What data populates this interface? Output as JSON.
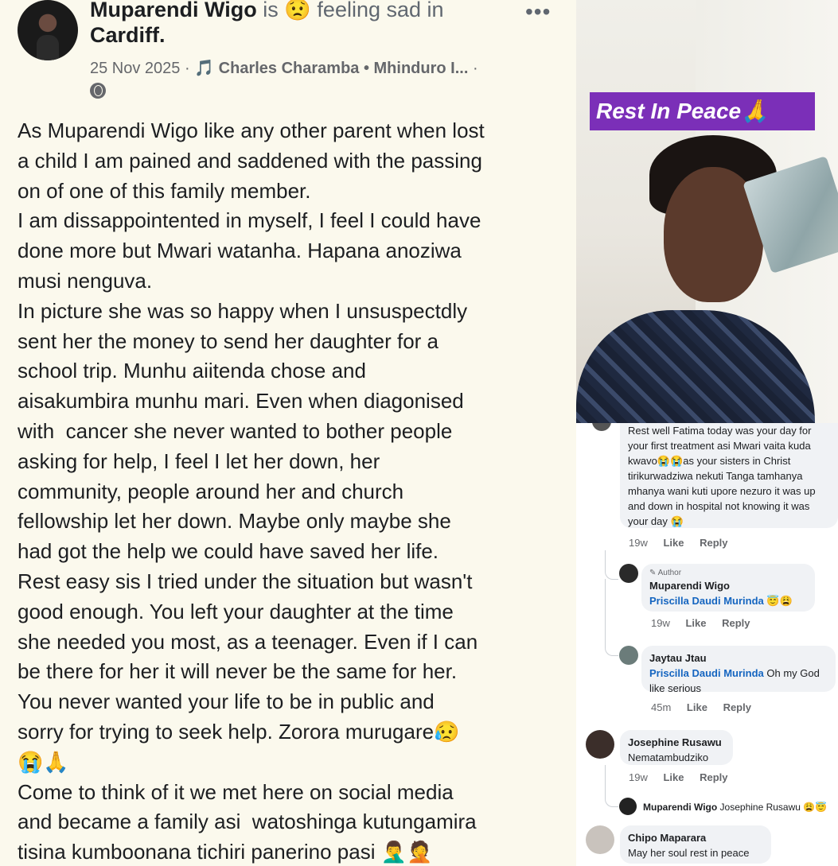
{
  "post": {
    "author_name": "Muparendi Wigo",
    "status_verb": "is",
    "feeling_emoji": "😟",
    "feeling_text": "feeling sad in",
    "location": "Cardiff.",
    "more_label": "•••",
    "date": "25 Nov 2025 ·",
    "music_icon": "🎵",
    "music_text": "Charles Charamba • Mhinduro I...",
    "trailing_dot": "·",
    "privacy_icon": "globe-icon",
    "body": "As Muparendi Wigo like any other parent when lost\na child I am pained and saddened with the passing\non of one of this family member.\nI am dissappointented in myself, I feel I could have\ndone more but Mwari watanha. Hapana anoziwa\nmusi nenguva.\nIn picture she was so happy when I unsuspectdly\nsent her the money to send her daughter for a\nschool trip. Munhu aiitenda chose and\naisakumbira munhu mari. Even when diagonised\nwith  cancer she never wanted to bother people\nasking for help, I feel I let her down, her\ncommunity, people around her and church\nfellowship let her down. Maybe only maybe she\nhad got the help we could have saved her life.\nRest easy sis I tried under the situation but wasn't\ngood enough. You left your daughter at the time\nshe needed you most, as a teenager. Even if I can\nbe there for her it will never be the same for her.\nYou never wanted your life to be in public and\nsorry for trying to seek help. Zorora murugare😥\n😭🙏\nCome to think of it we met here on social media\nand became a family asi  watoshinga kutungamira\ntisina kumboonana tichiri panerino pasi 🤦‍♂️🤦"
  },
  "photo": {
    "banner_text": "Rest In Peace🙏"
  },
  "comments": [
    {
      "text": "Rest well Fatima today was your day for your first treatment asi Mwari vaita kuda kwavo😭😭as your sisters in Christ tirikurwadziwa nekuti Tanga tamhanya mhanya wani  kuti upore nezuro it was up and down in hospital not knowing it was your day 😭",
      "time": "19w",
      "like": "Like",
      "reply": "Reply"
    },
    {
      "author_badge": "✎ Author",
      "name": "Muparendi Wigo",
      "tag": "Priscilla Daudi Murinda",
      "text": " 😇😩",
      "time": "19w",
      "like": "Like",
      "reply": "Reply"
    },
    {
      "name": "Jaytau Jtau",
      "tag": "Priscilla Daudi Murinda",
      "text": " Oh my God like serious",
      "time": "45m",
      "like": "Like",
      "reply": "Reply"
    },
    {
      "name": "Josephine Rusawu",
      "text": "Nematambudziko",
      "time": "19w",
      "like": "Like",
      "reply": "Reply"
    },
    {
      "name": "Muparendi Wigo",
      "text": " Josephine Rusawu 😩😇"
    },
    {
      "name": "Chipo Maparara",
      "text": "May her soul rest in peace"
    }
  ]
}
